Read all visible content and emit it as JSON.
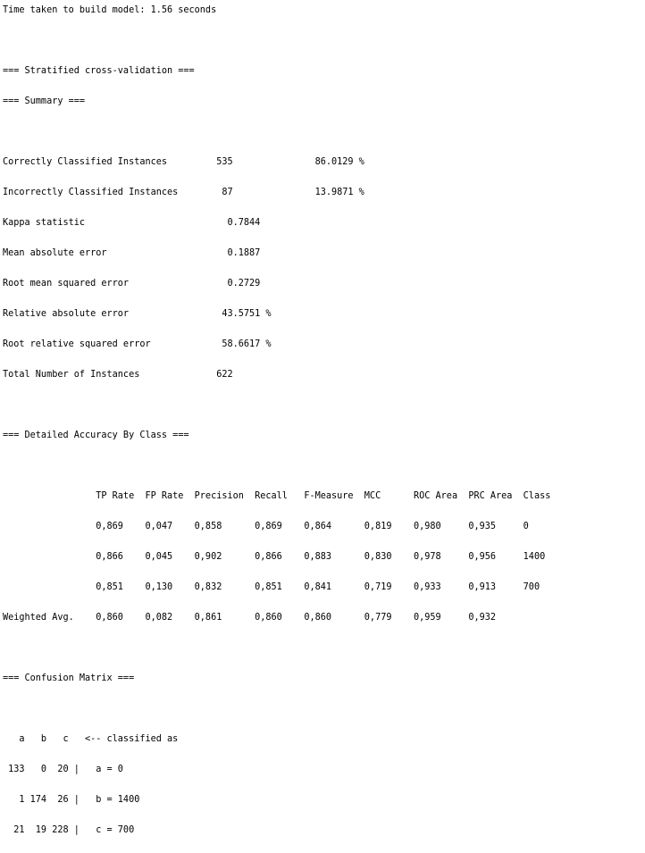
{
  "output_lines": [
    "Time taken to build model: 1.56 seconds",
    "",
    "=== Stratified cross-validation ===",
    "=== Summary ===",
    "",
    "Correctly Classified Instances         535               86.0129 %",
    "Incorrectly Classified Instances        87               13.9871 %",
    "Kappa statistic                          0.7844",
    "Mean absolute error                      0.1887",
    "Root mean squared error                  0.2729",
    "Relative absolute error                 43.5751 %",
    "Root relative squared error             58.6617 %",
    "Total Number of Instances              622     ",
    "",
    "=== Detailed Accuracy By Class ===",
    "",
    "                 TP Rate  FP Rate  Precision  Recall   F-Measure  MCC      ROC Area  PRC Area  Class",
    "                 0,869    0,047    0,858      0,869    0,864      0,819    0,980     0,935     0",
    "                 0,866    0,045    0,902      0,866    0,883      0,830    0,978     0,956     1400",
    "                 0,851    0,130    0,832      0,851    0,841      0,719    0,933     0,913     700",
    "Weighted Avg.    0,860    0,082    0,861      0,860    0,860      0,779    0,959     0,932     ",
    "",
    "=== Confusion Matrix ===",
    "",
    "   a   b   c   <-- classified as",
    " 133   0  20 |   a = 0",
    "   1 174  26 |   b = 1400",
    "  21  19 228 |   c = 700"
  ]
}
